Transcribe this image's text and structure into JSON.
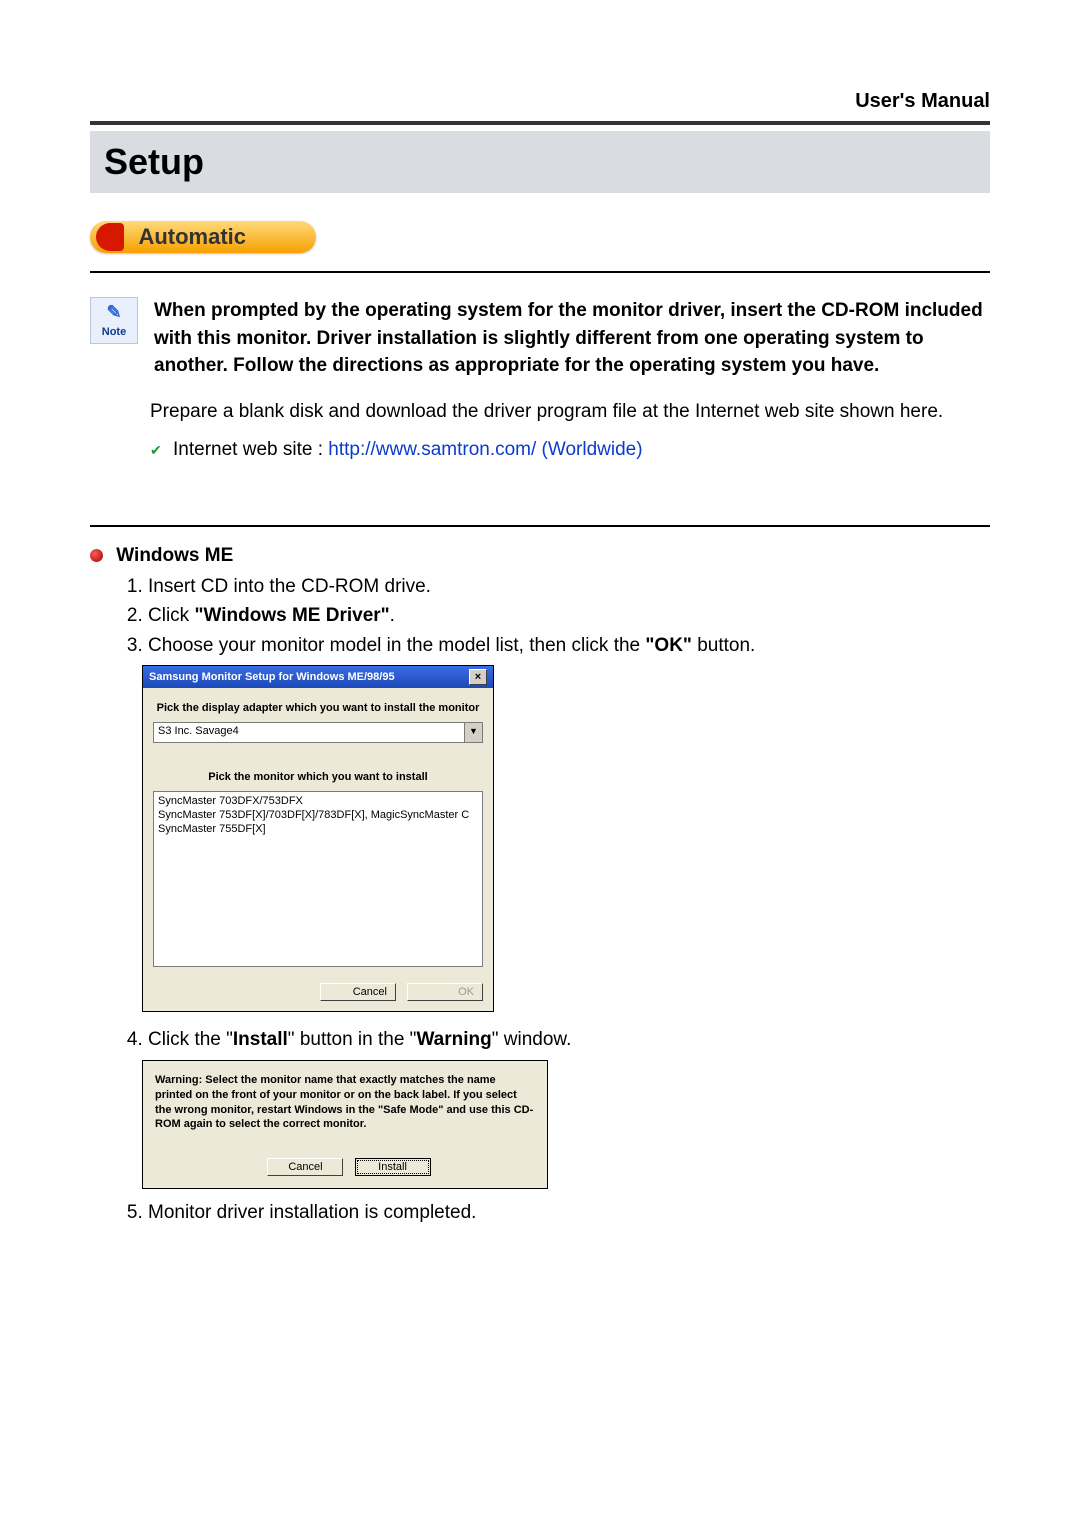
{
  "header": {
    "manual": "User's Manual"
  },
  "setup": {
    "title": "Setup",
    "pill": "Automatic"
  },
  "note": {
    "label": "Note",
    "text": "When prompted by the operating system for the monitor driver, insert the CD-ROM included with this monitor. Driver installation is slightly different from one operating system to another. Follow the directions as appropriate for the operating system you have."
  },
  "prepare": "Prepare a blank disk and download the driver program file at the Internet web site shown here.",
  "website_label": "Internet web site : ",
  "website_link": "http://www.samtron.com/ (Worldwide)",
  "winme": {
    "heading": "Windows ME",
    "steps": {
      "s1": "Insert CD into the CD-ROM drive.",
      "s2a": "Click ",
      "s2b": "\"Windows ME Driver\"",
      "s2c": ".",
      "s3a": "Choose your monitor model in the model list, then click the ",
      "s3b": "\"OK\"",
      "s3c": " button.",
      "s4a": "Click the \"",
      "s4b": "Install",
      "s4c": "\" button in the \"",
      "s4d": "Warning",
      "s4e": "\" window.",
      "s5": "Monitor driver installation is completed."
    }
  },
  "dialog1": {
    "title": "Samsung Monitor Setup for Windows  ME/98/95",
    "label1": "Pick the display adapter which you want to install the monitor",
    "combo": "S3 Inc. Savage4",
    "label2": "Pick the monitor which you want to install",
    "list": [
      "SyncMaster 703DFX/753DFX",
      "SyncMaster 753DF[X]/703DF[X]/783DF[X], MagicSyncMaster C",
      "SyncMaster 755DF[X]"
    ],
    "cancel": "Cancel",
    "ok": "OK"
  },
  "dialog2": {
    "warning": "Warning: Select the monitor name that exactly matches the name printed on the front of your monitor or on the back label. If you select the wrong monitor, restart Windows in the \"Safe Mode\" and use this CD-ROM again to select the correct monitor.",
    "cancel": "Cancel",
    "install": "Install"
  }
}
